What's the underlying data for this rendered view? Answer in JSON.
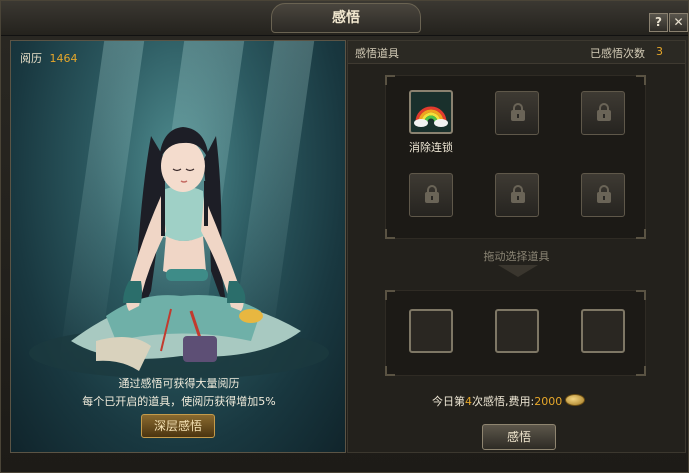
{
  "window": {
    "title": "感悟",
    "help_label": "?",
    "close_label": "✕"
  },
  "left": {
    "experience_label": "阅历",
    "experience_value": "1464",
    "hint_line1": "通过感悟可获得大量阅历",
    "hint_line2": "每个已开启的道具，使阅历获得增加5%",
    "deep_button": "深层感悟"
  },
  "right": {
    "header_title": "感悟道具",
    "count_label": "已感悟次数",
    "count_value": "3",
    "unlocked_item_label": "消除连锁",
    "drag_hint": "拖动选择道具",
    "cost": {
      "prefix": "今日第",
      "times": "4",
      "middle": "次感悟,费用:",
      "amount": "2000"
    },
    "gain_button": "感悟"
  },
  "colors": {
    "accent": "#e6a72a",
    "panel": "#23211c"
  },
  "icons": [
    "rainbow-icon",
    "lock-icon",
    "coin-icon",
    "help-icon",
    "close-icon"
  ]
}
